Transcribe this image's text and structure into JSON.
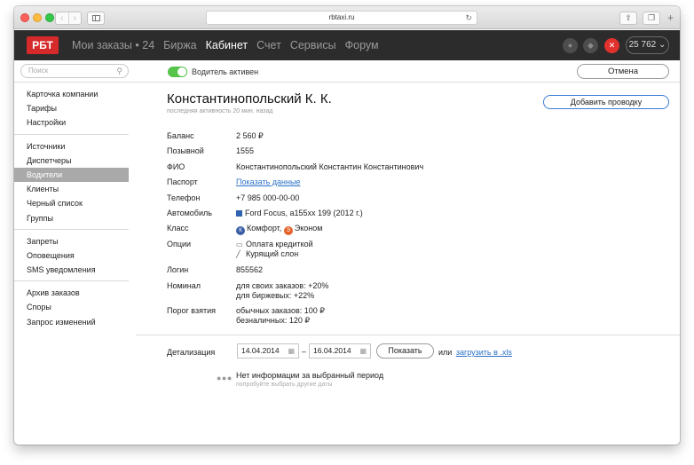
{
  "browser": {
    "url": "rbtaxi.ru",
    "plus_label": "+"
  },
  "appnav": {
    "logo": "РБТ",
    "links": [
      {
        "label": "Мои заказы • 24",
        "active": false
      },
      {
        "label": "Биржа",
        "active": false
      },
      {
        "label": "Кабинет",
        "active": true
      },
      {
        "label": "Счет",
        "active": false
      },
      {
        "label": "Сервисы",
        "active": false
      },
      {
        "label": "Форум",
        "active": false
      }
    ],
    "balance": "25 762 ⌄",
    "icons": [
      "user-icon",
      "chat-icon",
      "sound-off-icon"
    ]
  },
  "toolbar": {
    "search_placeholder": "Поиск",
    "toggle_label": "Водитель активен",
    "toggle_on": true,
    "cancel_label": "Отмена"
  },
  "menu": {
    "groups": [
      [
        "Карточка компании",
        "Тарифы",
        "Настройки"
      ],
      [
        "Источники",
        "Диспетчеры",
        "Водители",
        "Клиенты",
        "Черный список",
        "Группы"
      ],
      [
        "Запреты",
        "Оповещения",
        "SMS уведомления"
      ],
      [
        "Архив заказов",
        "Споры",
        "Запрос изменений"
      ]
    ],
    "active": "Водители"
  },
  "driver": {
    "name": "Константинопольский К. К.",
    "last_activity": "последняя активность 20 мин. назад",
    "add_entry_label": "Добавить проводку",
    "balance_label": "Баланс",
    "balance_value": "2 560 ₽",
    "callsign_label": "Позывной",
    "callsign_value": "1555",
    "fio_label": "ФИО",
    "fio_value": "Константинопольский Константин Константинович",
    "passport_label": "Паспорт",
    "passport_value": "Показать данные",
    "phone_label": "Телефон",
    "phone_value": "+7 985 000-00-00",
    "car_label": "Автомобиль",
    "car_value": "Ford Focus, а155хх 199 (2012 г.)",
    "car_color": "#2e63b0",
    "class_label": "Класс",
    "classes": [
      {
        "badge": "К",
        "name": "Комфорт",
        "color": "#3a5fa6"
      },
      {
        "badge": "Э",
        "name": "Эконом",
        "color": "#e5622b"
      }
    ],
    "options_label": "Опции",
    "options": [
      "Оплата кредиткой",
      "Курящий слон"
    ],
    "login_label": "Логин",
    "login_value": "855562",
    "nominal_label": "Номинал",
    "nominal_lines": [
      "для своих заказов: +20%",
      "для биржевых: +22%"
    ],
    "threshold_label": "Порог взятия",
    "threshold_lines": [
      "обычных заказов: 100 ₽",
      "безналичных: 120 ₽"
    ]
  },
  "details": {
    "label": "Детализация",
    "date_from": "14.04.2014",
    "dash": "–",
    "date_to": "16.04.2014",
    "show_label": "Показать",
    "or_text": "или",
    "download_label": "загрузить в .xls",
    "no_info": "Нет информации за выбранный период",
    "no_info_hint": "попробуйте выбрать другие даты"
  }
}
